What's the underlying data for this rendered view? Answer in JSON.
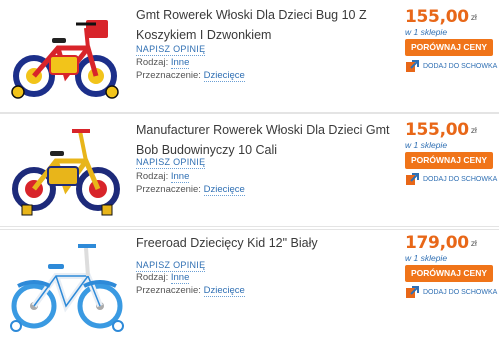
{
  "offers": [
    {
      "title": "Gmt Rowerek Włoski Dla Dzieci Bug 10 Z Koszykiem I Dzwonkiem",
      "review_link": "NAPISZ OPINIĘ",
      "brand_label": "Rodzaj:",
      "brand_value": "Inne",
      "purpose_label": "Przeznaczenie:",
      "purpose_value": "Dziecięce",
      "price": "155,00",
      "currency": "zł",
      "store_count": "w 1 sklepie",
      "compare_button": "PORÓWNAJ CENY",
      "stash_label": "DODAJ DO SCHOWKA",
      "bike_colors": {
        "frame": "#d8242a",
        "accent": "#f2c41a",
        "wheel": "#1c2f8a"
      }
    },
    {
      "title": "Manufacturer Rowerek Włoski Dla Dzieci Gmt Bob Budowinyczy 10 Cali",
      "review_link": "NAPISZ OPINIĘ",
      "brand_label": "Rodzaj:",
      "brand_value": "Inne",
      "purpose_label": "Przeznaczenie:",
      "purpose_value": "Dziecięce",
      "price": "155,00",
      "currency": "zł",
      "store_count": "w 1 sklepie",
      "compare_button": "PORÓWNAJ CENY",
      "stash_label": "DODAJ DO SCHOWKA",
      "bike_colors": {
        "frame": "#e8b51a",
        "accent": "#d8242a",
        "wheel": "#1d2a7a"
      }
    },
    {
      "title": "Freeroad Dziecięcy Kid 12\" Biały",
      "review_link": "NAPISZ OPINIĘ",
      "brand_label": "Rodzaj:",
      "brand_value": "Inne",
      "purpose_label": "Przeznaczenie:",
      "purpose_value": "Dziecięce",
      "price": "179,00",
      "currency": "zł",
      "store_count": "w 1 sklepie",
      "compare_button": "PORÓWNAJ CENY",
      "stash_label": "DODAJ DO SCHOWKA",
      "bike_colors": {
        "frame": "#ffffff",
        "accent": "#2e8ad8",
        "wheel": "#3a9ae2"
      }
    }
  ],
  "colors": {
    "accent": "#f07419",
    "price": "#e86718",
    "link": "#2f6fb3"
  }
}
